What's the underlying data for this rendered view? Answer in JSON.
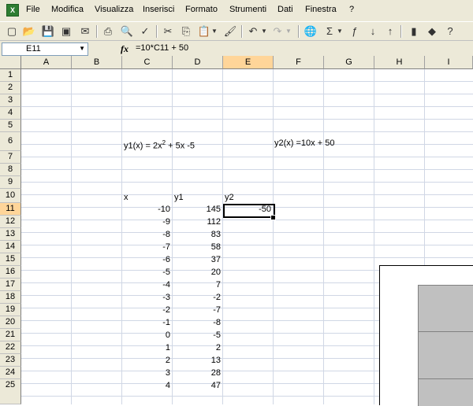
{
  "menu": {
    "items": [
      "File",
      "Modifica",
      "Visualizza",
      "Inserisci",
      "Formato",
      "Strumenti",
      "Dati",
      "Finestra",
      "?"
    ]
  },
  "formula_bar": {
    "name_box": "E11",
    "fx": "fx",
    "formula": "=10*C11 + 50"
  },
  "columns": [
    "A",
    "B",
    "C",
    "D",
    "E",
    "F",
    "G",
    "H",
    "I"
  ],
  "active_column": "E",
  "active_row": 11,
  "rows": [
    1,
    2,
    3,
    4,
    5,
    6,
    7,
    8,
    9,
    10,
    11,
    12,
    13,
    14,
    15,
    16,
    17,
    18,
    19,
    20,
    21,
    22,
    23,
    24,
    25
  ],
  "labels": {
    "y1_formula_prefix": "y1(x) = 2x",
    "y1_formula_sup": "2",
    "y1_formula_suffix": " + 5x -5",
    "y2_formula": "y2(x) =10x + 50",
    "col_x": "x",
    "col_y1": "y1",
    "col_y2": "y2"
  },
  "table": {
    "x": [
      -10,
      -9,
      -8,
      -7,
      -6,
      -5,
      -4,
      -3,
      -2,
      -1,
      0,
      1,
      2,
      3,
      4
    ],
    "y1": [
      145,
      112,
      83,
      58,
      37,
      20,
      7,
      -2,
      -7,
      -8,
      -5,
      2,
      13,
      28,
      47
    ],
    "y2": [
      "-50"
    ]
  },
  "colors": {
    "active_header": "#ffd599",
    "chrome": "#ece9d8",
    "gridline": "#d0d7e5",
    "chart_plot": "#c0c0c0"
  }
}
